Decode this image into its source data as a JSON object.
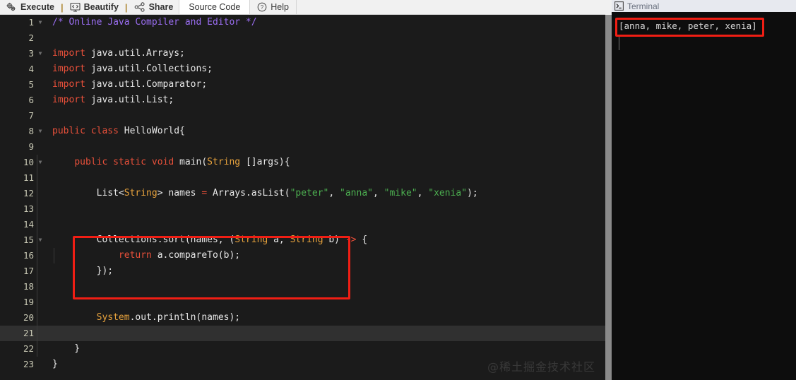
{
  "toolbar": {
    "execute_label": "Execute",
    "execute_icon": "gears-icon",
    "beautify_label": "Beautify",
    "beautify_icon": "code-monitor-icon",
    "share_label": "Share",
    "share_icon": "share-nodes-icon",
    "source_code_tab": "Source Code",
    "help_label": "Help",
    "help_icon": "question-circle-icon",
    "separator": "|"
  },
  "editor": {
    "language": "java",
    "active_line": 21,
    "lines": [
      {
        "n": "1",
        "fold": true,
        "indent": 0,
        "tokens": [
          {
            "t": "com",
            "v": "/* Online Java Compiler and Editor */"
          }
        ]
      },
      {
        "n": "2",
        "fold": false,
        "indent": 0,
        "tokens": []
      },
      {
        "n": "3",
        "fold": true,
        "indent": 0,
        "tokens": [
          {
            "t": "key",
            "v": "import"
          },
          {
            "t": "pln",
            "v": " java.util.Arrays;"
          }
        ]
      },
      {
        "n": "4",
        "fold": false,
        "indent": 0,
        "tokens": [
          {
            "t": "key",
            "v": "import"
          },
          {
            "t": "pln",
            "v": " java.util.Collections;"
          }
        ]
      },
      {
        "n": "5",
        "fold": false,
        "indent": 0,
        "tokens": [
          {
            "t": "key",
            "v": "import"
          },
          {
            "t": "pln",
            "v": " java.util.Comparator;"
          }
        ]
      },
      {
        "n": "6",
        "fold": false,
        "indent": 0,
        "tokens": [
          {
            "t": "key",
            "v": "import"
          },
          {
            "t": "pln",
            "v": " java.util.List;"
          }
        ]
      },
      {
        "n": "7",
        "fold": false,
        "indent": 0,
        "tokens": []
      },
      {
        "n": "8",
        "fold": true,
        "indent": 0,
        "tokens": [
          {
            "t": "key",
            "v": "public class"
          },
          {
            "t": "pln",
            "v": " HelloWorld{"
          }
        ]
      },
      {
        "n": "9",
        "fold": false,
        "indent": 0,
        "tokens": []
      },
      {
        "n": "10",
        "fold": true,
        "indent": 1,
        "tokens": [
          {
            "t": "pln",
            "v": "    "
          },
          {
            "t": "key",
            "v": "public static void"
          },
          {
            "t": "pln",
            "v": " main("
          },
          {
            "t": "type",
            "v": "String"
          },
          {
            "t": "pln",
            "v": " []args){"
          }
        ]
      },
      {
        "n": "11",
        "fold": false,
        "indent": 1,
        "tokens": []
      },
      {
        "n": "12",
        "fold": false,
        "indent": 1,
        "tokens": [
          {
            "t": "pln",
            "v": "        List<"
          },
          {
            "t": "type",
            "v": "String"
          },
          {
            "t": "pln",
            "v": "> names "
          },
          {
            "t": "op",
            "v": "="
          },
          {
            "t": "pln",
            "v": " Arrays.asList("
          },
          {
            "t": "str",
            "v": "\"peter\""
          },
          {
            "t": "pln",
            "v": ", "
          },
          {
            "t": "str",
            "v": "\"anna\""
          },
          {
            "t": "pln",
            "v": ", "
          },
          {
            "t": "str",
            "v": "\"mike\""
          },
          {
            "t": "pln",
            "v": ", "
          },
          {
            "t": "str",
            "v": "\"xenia\""
          },
          {
            "t": "pln",
            "v": ");"
          }
        ]
      },
      {
        "n": "13",
        "fold": false,
        "indent": 1,
        "tokens": []
      },
      {
        "n": "14",
        "fold": false,
        "indent": 1,
        "tokens": []
      },
      {
        "n": "15",
        "fold": true,
        "indent": 1,
        "tokens": [
          {
            "t": "pln",
            "v": "        Collections.sort(names, ("
          },
          {
            "t": "type",
            "v": "String"
          },
          {
            "t": "pln",
            "v": " a, "
          },
          {
            "t": "type",
            "v": "String"
          },
          {
            "t": "pln",
            "v": " b) "
          },
          {
            "t": "op",
            "v": "->"
          },
          {
            "t": "pln",
            "v": " {"
          }
        ]
      },
      {
        "n": "16",
        "fold": false,
        "indent": 2,
        "tokens": [
          {
            "t": "pln",
            "v": "            "
          },
          {
            "t": "key",
            "v": "return"
          },
          {
            "t": "pln",
            "v": " a.compareTo(b);"
          }
        ]
      },
      {
        "n": "17",
        "fold": false,
        "indent": 1,
        "tokens": [
          {
            "t": "pln",
            "v": "        });"
          }
        ]
      },
      {
        "n": "18",
        "fold": false,
        "indent": 1,
        "tokens": []
      },
      {
        "n": "19",
        "fold": false,
        "indent": 1,
        "tokens": []
      },
      {
        "n": "20",
        "fold": false,
        "indent": 1,
        "tokens": [
          {
            "t": "pln",
            "v": "        "
          },
          {
            "t": "type",
            "v": "System"
          },
          {
            "t": "pln",
            "v": ".out.println(names);"
          }
        ]
      },
      {
        "n": "21",
        "fold": false,
        "indent": 1,
        "tokens": []
      },
      {
        "n": "22",
        "fold": false,
        "indent": 1,
        "tokens": [
          {
            "t": "pln",
            "v": "    }"
          }
        ]
      },
      {
        "n": "23",
        "fold": false,
        "indent": 0,
        "tokens": [
          {
            "t": "pln",
            "v": "}"
          }
        ]
      }
    ],
    "highlight_annotation": {
      "color": "#f01e14",
      "covers_lines": "15-17"
    }
  },
  "terminal": {
    "title": "Terminal",
    "icon": "terminal-prompt-icon",
    "output": "[anna, mike, peter, xenia]",
    "highlight_annotation": {
      "color": "#f01e14"
    }
  },
  "watermark": {
    "text": "@稀土掘金技术社区"
  },
  "colors": {
    "editor_bg": "#1b1b1b",
    "terminal_bg": "#0d0d0d",
    "active_line": "#303030",
    "comment": "#9b6ef3",
    "keyword": "#e8503a",
    "type": "#e8a33d",
    "string": "#4caf50",
    "plain": "#e8e8e8",
    "annotation_red": "#f01e14",
    "toolbar_bg": "#f1f1f1"
  }
}
